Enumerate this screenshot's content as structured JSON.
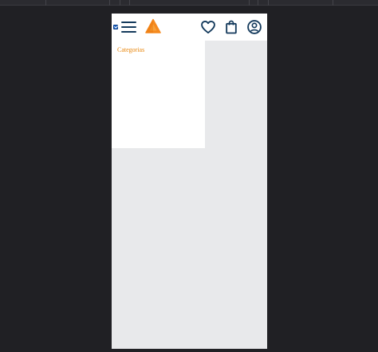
{
  "header": {
    "menu_toggle_checked": true,
    "icons": {
      "menu": "hamburger-icon",
      "logo": "triangle-logo",
      "favorites": "heart-icon",
      "cart": "shopping-bag-icon",
      "account": "user-circle-icon"
    }
  },
  "drawer": {
    "title": "Categorias"
  },
  "colors": {
    "brand_orange": "#f58a1f",
    "drawer_title": "#e8860c",
    "icon_navy": "#143a5c",
    "page_background": "#e8e9eb",
    "outer_background": "#202024"
  }
}
